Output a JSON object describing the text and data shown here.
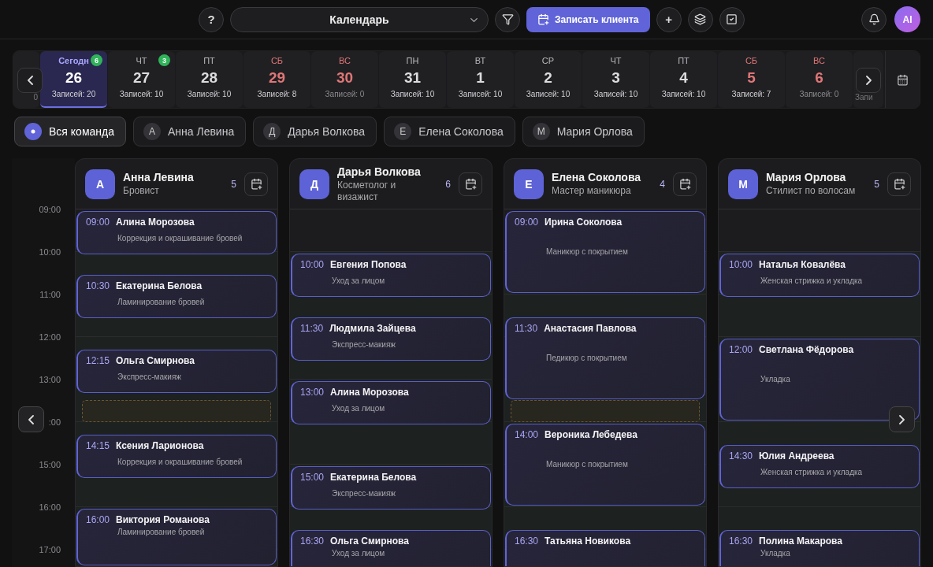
{
  "topbar": {
    "help": "?",
    "view_select": "Календарь",
    "primary_button": "Записать клиента",
    "plus": "+",
    "avatar": "AI"
  },
  "days": [
    {
      "kind": "partial_left",
      "count": "0"
    },
    {
      "kind": "day",
      "weekday": "Сегодн",
      "date": "26",
      "count": "Записей: 20",
      "selected": true,
      "weekend": false,
      "badge": "6"
    },
    {
      "kind": "day",
      "weekday": "ЧТ",
      "date": "27",
      "count": "Записей: 10",
      "selected": false,
      "weekend": false,
      "badge": "3"
    },
    {
      "kind": "day",
      "weekday": "ПТ",
      "date": "28",
      "count": "Записей: 10",
      "selected": false,
      "weekend": false
    },
    {
      "kind": "day",
      "weekday": "СБ",
      "date": "29",
      "count": "Записей: 8",
      "selected": false,
      "weekend": true
    },
    {
      "kind": "day",
      "weekday": "ВС",
      "date": "30",
      "count": "Записей: 0",
      "selected": false,
      "weekend": true
    },
    {
      "kind": "day",
      "weekday": "ПН",
      "date": "31",
      "count": "Записей: 10",
      "selected": false,
      "weekend": false
    },
    {
      "kind": "day",
      "weekday": "ВТ",
      "date": "1",
      "count": "Записей: 10",
      "selected": false,
      "weekend": false
    },
    {
      "kind": "day",
      "weekday": "СР",
      "date": "2",
      "count": "Записей: 10",
      "selected": false,
      "weekend": false
    },
    {
      "kind": "day",
      "weekday": "ЧТ",
      "date": "3",
      "count": "Записей: 10",
      "selected": false,
      "weekend": false
    },
    {
      "kind": "day",
      "weekday": "ПТ",
      "date": "4",
      "count": "Записей: 10",
      "selected": false,
      "weekend": false
    },
    {
      "kind": "day",
      "weekday": "СБ",
      "date": "5",
      "count": "Записей: 7",
      "selected": false,
      "weekend": true
    },
    {
      "kind": "day",
      "weekday": "ВС",
      "date": "6",
      "count": "Записей: 0",
      "selected": false,
      "weekend": true
    },
    {
      "kind": "partial_right",
      "count": "Запи"
    }
  ],
  "team_filter": [
    {
      "kind": "all",
      "label": "Вся команда",
      "selected": true
    },
    {
      "kind": "member",
      "initial": "А",
      "label": "Анна Левина",
      "selected": false
    },
    {
      "kind": "member",
      "initial": "Д",
      "label": "Дарья Волкова",
      "selected": false
    },
    {
      "kind": "member",
      "initial": "Е",
      "label": "Елена Соколова",
      "selected": false
    },
    {
      "kind": "member",
      "initial": "М",
      "label": "Мария Орлова",
      "selected": false
    }
  ],
  "time_labels": [
    "09:00",
    "10:00",
    "11:00",
    "12:00",
    "13:00",
    ":00",
    "15:00",
    "16:00",
    "17:00"
  ],
  "staff": [
    {
      "initial": "А",
      "name": "Анна Левина",
      "role": "Бровист",
      "count": "5",
      "appointments": [
        {
          "time": "09:00",
          "client": "Алина Морозова",
          "service": "Коррекция и окрашивание бровей"
        },
        {
          "time": "10:30",
          "client": "Екатерина Белова",
          "service": "Ламинирование бровей"
        },
        {
          "time": "12:15",
          "client": "Ольга Смирнова",
          "service": "Экспресс-макияж"
        },
        {
          "time": "14:15",
          "client": "Ксения Ларионова",
          "service": "Коррекция и окрашивание бровей"
        },
        {
          "time": "16:00",
          "client": "Виктория Романова",
          "service": "Ламинирование бровей"
        }
      ]
    },
    {
      "initial": "Д",
      "name": "Дарья Волкова",
      "role": "Косметолог и визажист",
      "count": "6",
      "appointments": [
        {
          "time": "10:00",
          "client": "Евгения Попова",
          "service": "Уход за лицом"
        },
        {
          "time": "11:30",
          "client": "Людмила Зайцева",
          "service": "Экспресс-макияж"
        },
        {
          "time": "13:00",
          "client": "Алина Морозова",
          "service": "Уход за лицом"
        },
        {
          "time": "15:00",
          "client": "Екатерина Белова",
          "service": "Экспресс-макияж"
        },
        {
          "time": "16:30",
          "client": "Ольга Смирнова",
          "service": "Уход за лицом"
        }
      ]
    },
    {
      "initial": "Е",
      "name": "Елена Соколова",
      "role": "Мастер маникюра",
      "count": "4",
      "appointments": [
        {
          "time": "09:00",
          "client": "Ирина Соколова",
          "service": "Маникюр с покрытием"
        },
        {
          "time": "11:30",
          "client": "Анастасия Павлова",
          "service": "Педикюр с покрытием"
        },
        {
          "time": "14:00",
          "client": "Вероника Лебедева",
          "service": "Маникюр с покрытием"
        },
        {
          "time": "16:30",
          "client": "Татьяна Новикова"
        }
      ]
    },
    {
      "initial": "М",
      "name": "Мария Орлова",
      "role": "Стилист по волосам",
      "count": "5",
      "appointments": [
        {
          "time": "10:00",
          "client": "Наталья Ковалёва",
          "service": "Женская стрижка и укладка"
        },
        {
          "time": "12:00",
          "client": "Светлана Фёдорова",
          "service": "Укладка"
        },
        {
          "time": "14:30",
          "client": "Юлия Андреева",
          "service": "Женская стрижка и укладка"
        },
        {
          "time": "16:30",
          "client": "Полина Макарова",
          "service": "Укладка"
        }
      ]
    }
  ]
}
